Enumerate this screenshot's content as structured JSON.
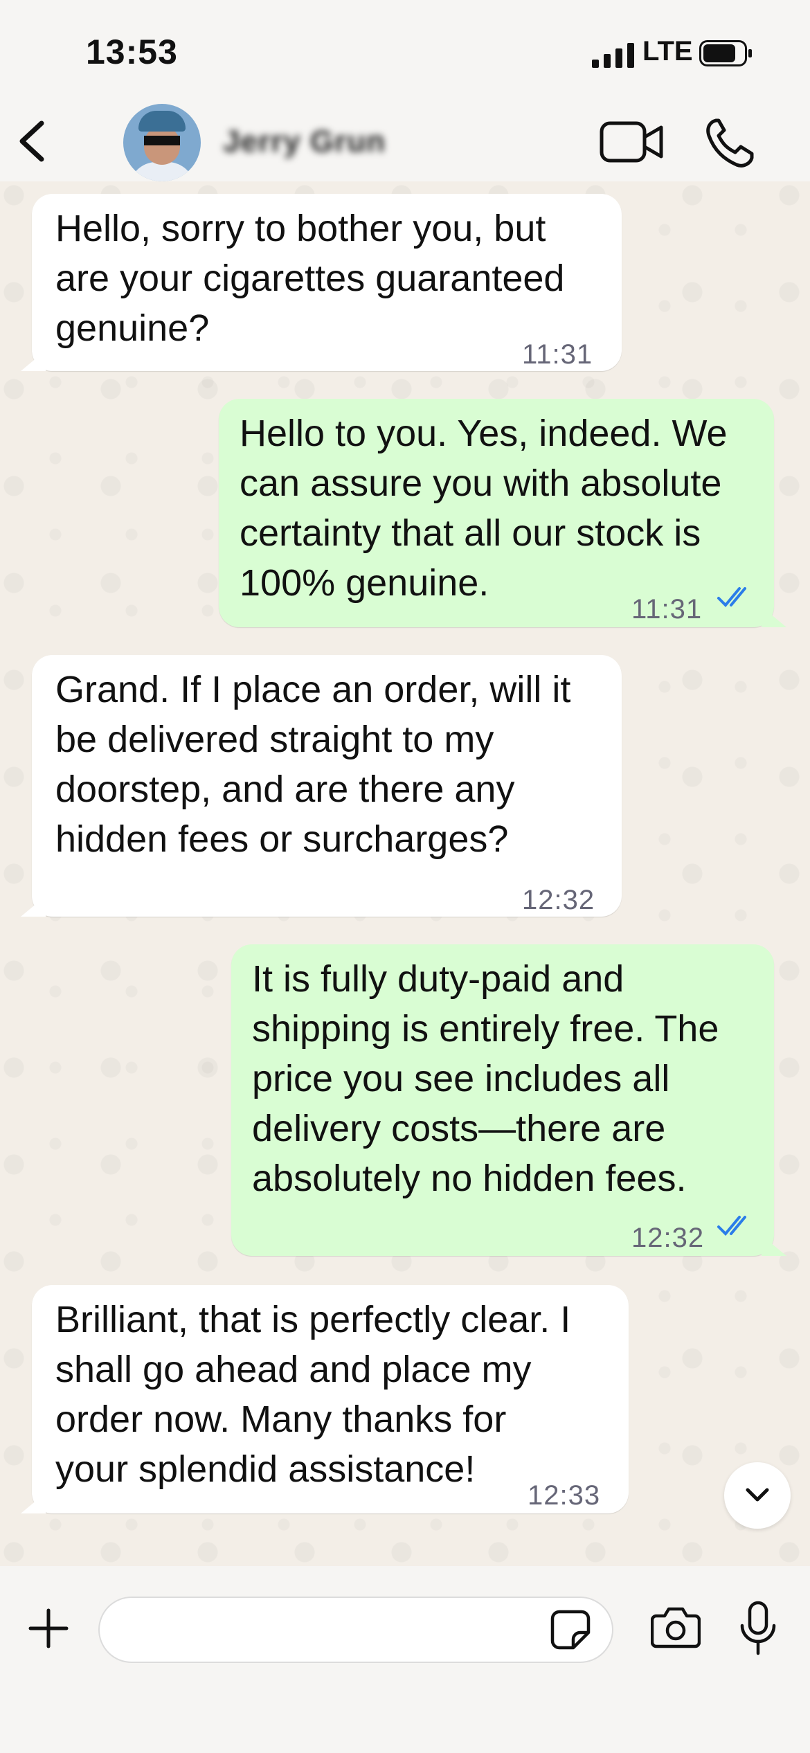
{
  "status_bar": {
    "time": "13:53",
    "network": "LTE"
  },
  "header": {
    "contact_name": "Jerry Grun"
  },
  "messages": [
    {
      "direction": "incoming",
      "text": "Hello, sorry to bother you, but\nare your cigarettes guaranteed\ngenuine?",
      "time": "11:31"
    },
    {
      "direction": "outgoing",
      "text": "Hello to you. Yes, indeed. We\ncan assure you with absolute\ncertainty that all our stock is\n100% genuine.",
      "time": "11:31",
      "status": "read"
    },
    {
      "direction": "incoming",
      "text": "Grand. If I place an order, will it\nbe delivered straight to my\ndoorstep, and are there any\nhidden fees or surcharges?",
      "time": "12:32"
    },
    {
      "direction": "outgoing",
      "text": "It is fully duty-paid and\nshipping is entirely free. The\nprice you see includes all\ndelivery costs—there are\nabsolutely no hidden fees.",
      "time": "12:32",
      "status": "read"
    },
    {
      "direction": "incoming",
      "text": "Brilliant, that is perfectly clear. I\nshall go ahead and place my\norder now. Many thanks for\nyour splendid assistance!",
      "time": "12:33"
    }
  ],
  "composer": {
    "placeholder": ""
  },
  "colors": {
    "outgoing_bubble": "#d9fdd3",
    "incoming_bubble": "#ffffff",
    "read_ticks": "#2b7de9"
  },
  "icons": [
    "back-icon",
    "video-call-icon",
    "phone-icon",
    "plus-icon",
    "sticker-icon",
    "camera-icon",
    "microphone-icon",
    "chevron-down-icon",
    "double-check-icon"
  ]
}
